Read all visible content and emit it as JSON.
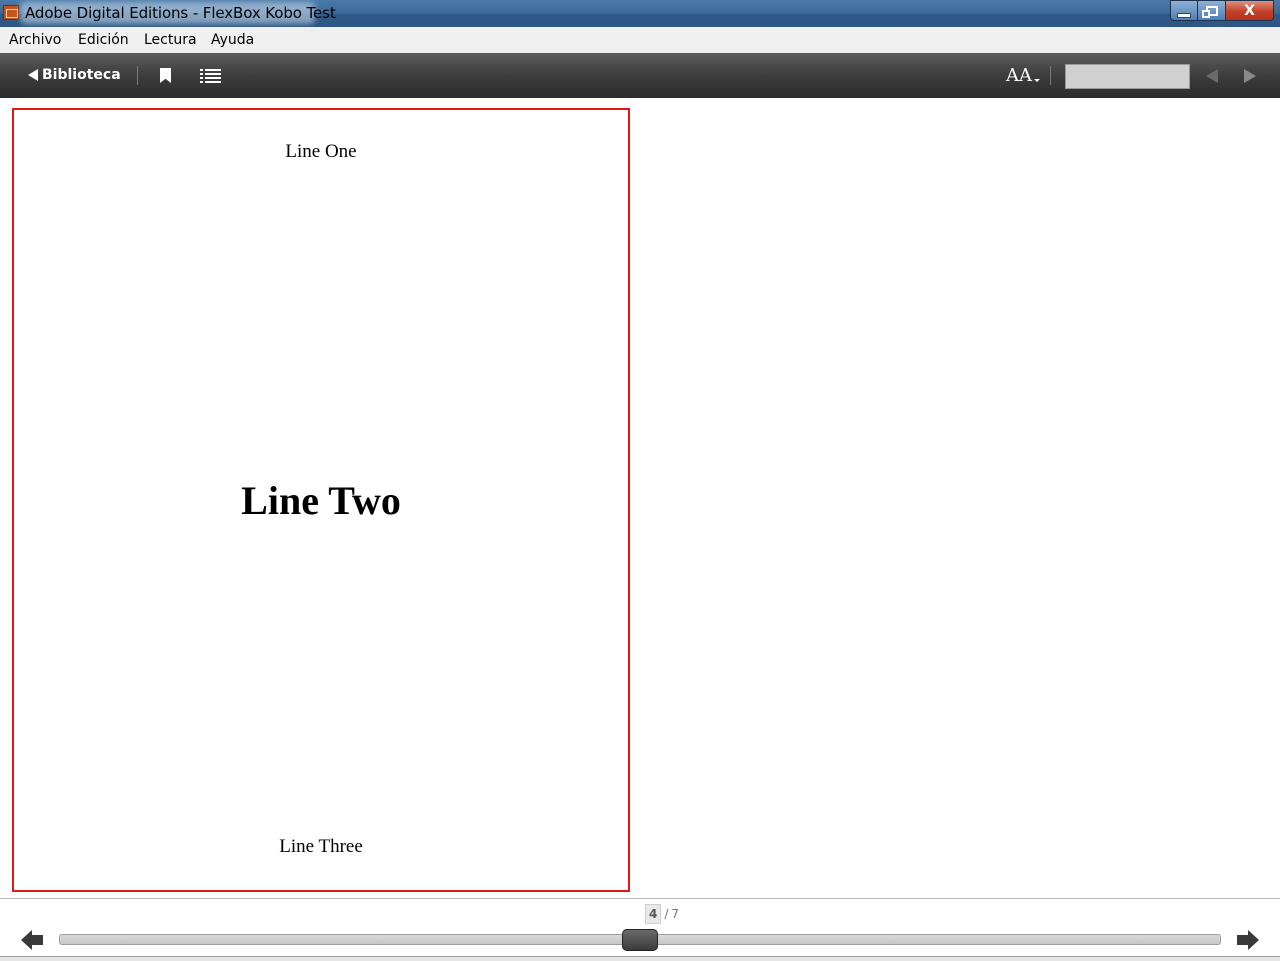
{
  "window": {
    "title": "Adobe Digital Editions - FlexBox Kobo Test",
    "icon": "adobe-digital-editions-icon",
    "controls": [
      "minimize-icon",
      "maximize-icon",
      "close-icon"
    ],
    "close_label": "X"
  },
  "menu": {
    "items": [
      {
        "label": "Archivo"
      },
      {
        "label": "Edición"
      },
      {
        "label": "Lectura"
      },
      {
        "label": "Ayuda"
      }
    ]
  },
  "toolbar": {
    "library_label": "Biblioteca",
    "font_size_label": "AA",
    "icons": [
      "back-triangle-icon",
      "bookmark-icon",
      "table-of-contents-icon",
      "font-size-icon",
      "previous-result-icon",
      "next-result-icon"
    ],
    "search": {
      "value": "",
      "placeholder": ""
    }
  },
  "page": {
    "line_one": "Line One",
    "line_two": "Line Two",
    "line_three": "Line Three",
    "border_color": "#e01818"
  },
  "navigation": {
    "current_page": "4",
    "separator": "/",
    "total_pages": "7",
    "progress": 0.5
  }
}
